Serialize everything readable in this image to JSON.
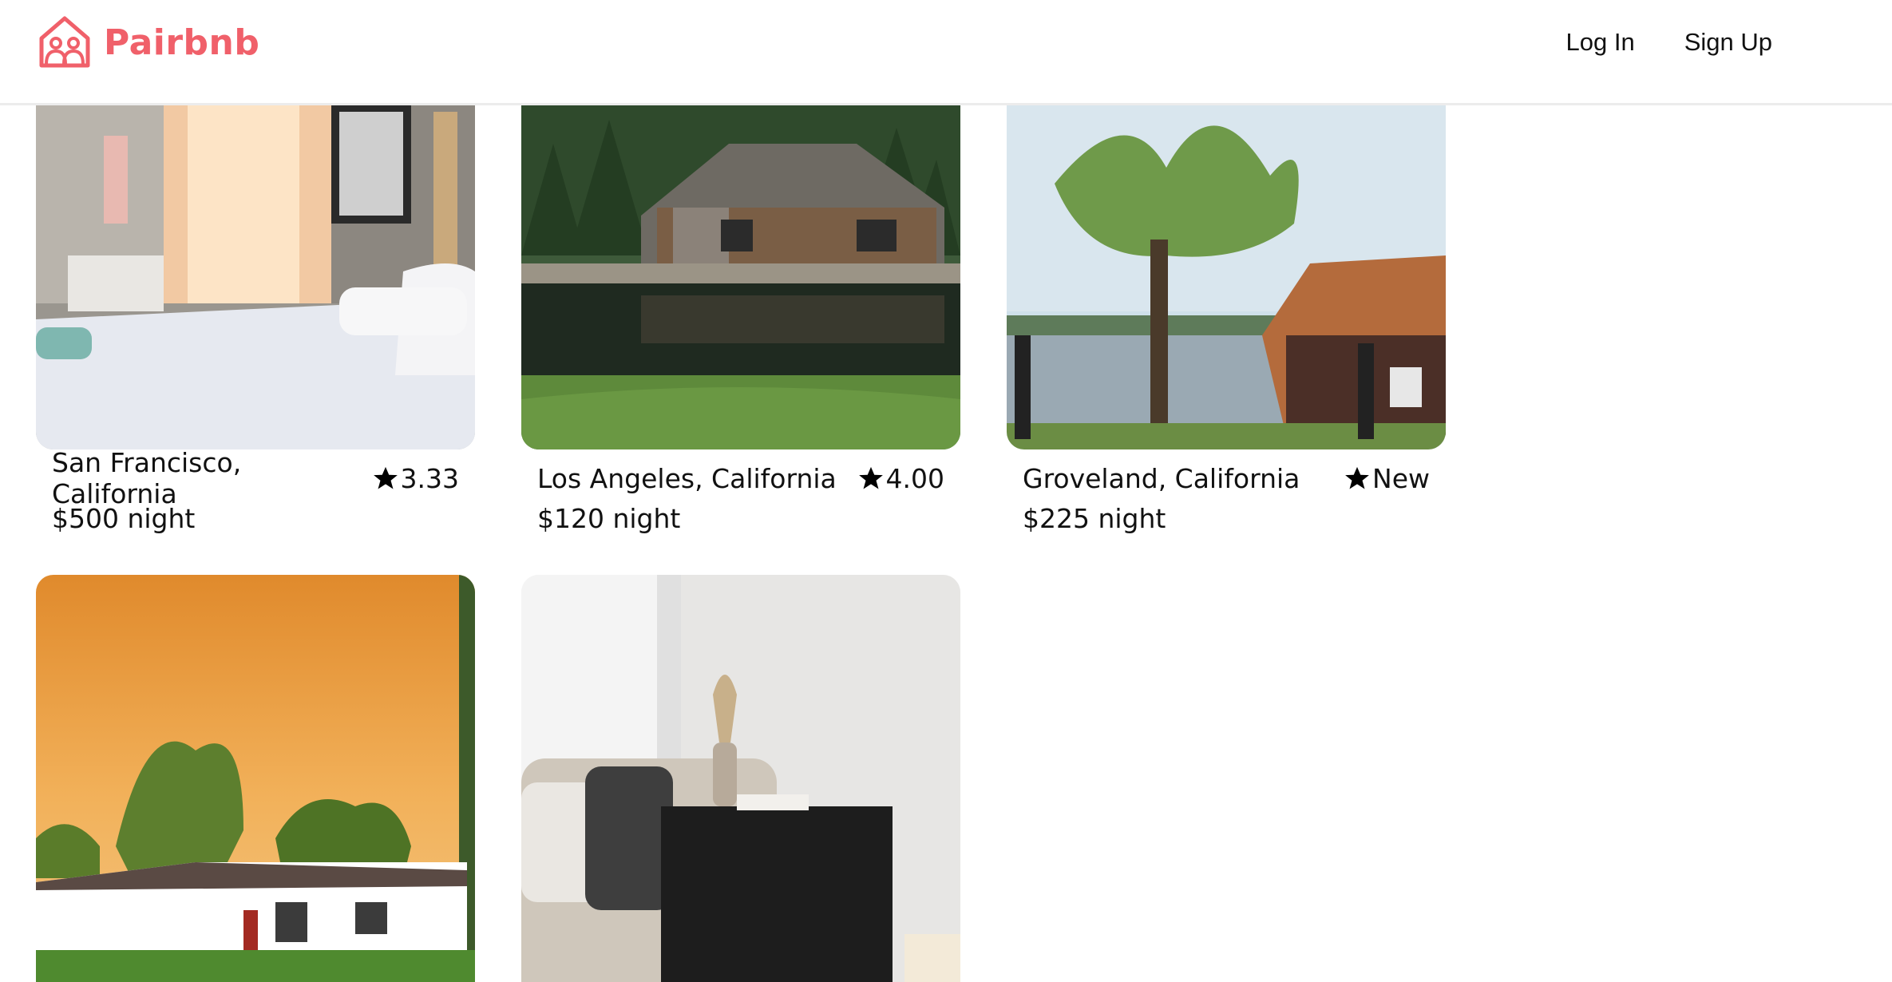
{
  "brand": {
    "name": "Pairbnb",
    "color": "#f0606a",
    "icon": "house-people-icon"
  },
  "nav": {
    "login": "Log In",
    "signup": "Sign Up"
  },
  "listings": [
    {
      "title": "San Francisco, California",
      "rating": "3.33",
      "price": "$500 night",
      "image": "bedroom-photo"
    },
    {
      "title": "Los Angeles, California",
      "rating": "4.00",
      "price": "$120 night",
      "image": "lake-cabin-photo"
    },
    {
      "title": "Groveland, California",
      "rating": "New",
      "price": "$225 night",
      "image": "lakeside-tree-cabin-photo"
    },
    {
      "title": "",
      "rating": "",
      "price": "",
      "image": "suburban-house-sunset-photo"
    },
    {
      "title": "",
      "rating": "",
      "price": "",
      "image": "living-room-sofa-photo"
    }
  ]
}
